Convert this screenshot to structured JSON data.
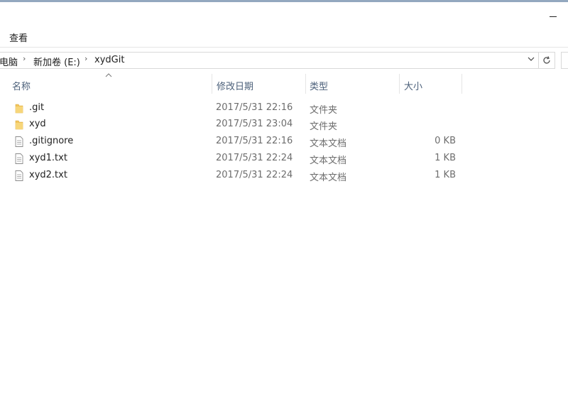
{
  "window": {
    "minimize_icon": "minimize-icon"
  },
  "ribbon": {
    "view_tab": "查看"
  },
  "address_bar": {
    "crumbs": [
      "电脑",
      "新加卷 (E:)",
      "xydGit"
    ],
    "separator_icon": "chevron-right-icon",
    "dropdown_icon": "chevron-down-icon",
    "refresh_icon": "refresh-icon"
  },
  "columns": {
    "name": "名称",
    "date": "修改日期",
    "type": "类型",
    "size": "大小",
    "sort_icon": "sort-up-caret-icon"
  },
  "files": [
    {
      "name": ".git",
      "date": "2017/5/31 22:16",
      "type": "文件夹",
      "size": "",
      "icon": "folder-icon"
    },
    {
      "name": "xyd",
      "date": "2017/5/31 23:04",
      "type": "文件夹",
      "size": "",
      "icon": "folder-icon"
    },
    {
      "name": ".gitignore",
      "date": "2017/5/31 22:16",
      "type": "文本文档",
      "size": "0 KB",
      "icon": "text-file-icon"
    },
    {
      "name": "xyd1.txt",
      "date": "2017/5/31 22:24",
      "type": "文本文档",
      "size": "1 KB",
      "icon": "text-file-icon"
    },
    {
      "name": "xyd2.txt",
      "date": "2017/5/31 22:24",
      "type": "文本文档",
      "size": "1 KB",
      "icon": "text-file-icon"
    }
  ],
  "colors": {
    "folder": "#f2c55c",
    "header_text": "#4c607a",
    "accent_bar": "#93a8bf"
  }
}
